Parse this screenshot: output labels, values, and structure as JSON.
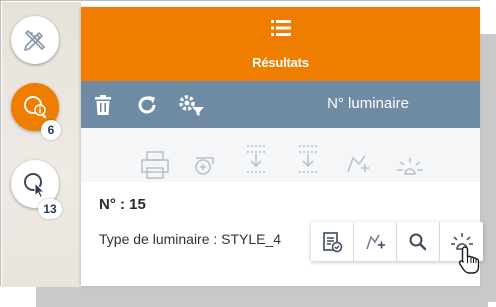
{
  "header": {
    "title": "Résultats",
    "icon": "list-icon"
  },
  "toolbar": {
    "title": "N° luminaire",
    "icons": [
      "trash-icon",
      "refresh-icon",
      "settings-filter-icon"
    ]
  },
  "left_rail": {
    "tools_icon": "pencil-ruler-icon",
    "info_icon": "info-query-icon",
    "info_count": "6",
    "select_icon": "selection-cursor-icon",
    "select_count": "13"
  },
  "result": {
    "number": "N° : 15",
    "type_text": "Type de luminaire : STYLE_4"
  },
  "actions": [
    "report-icon",
    "edit-geometry-icon",
    "zoom-icon",
    "highlight-icon"
  ],
  "colors": {
    "accent": "#ef7d00",
    "toolbar": "#6f8aa3",
    "text": "#2b2b2b"
  }
}
